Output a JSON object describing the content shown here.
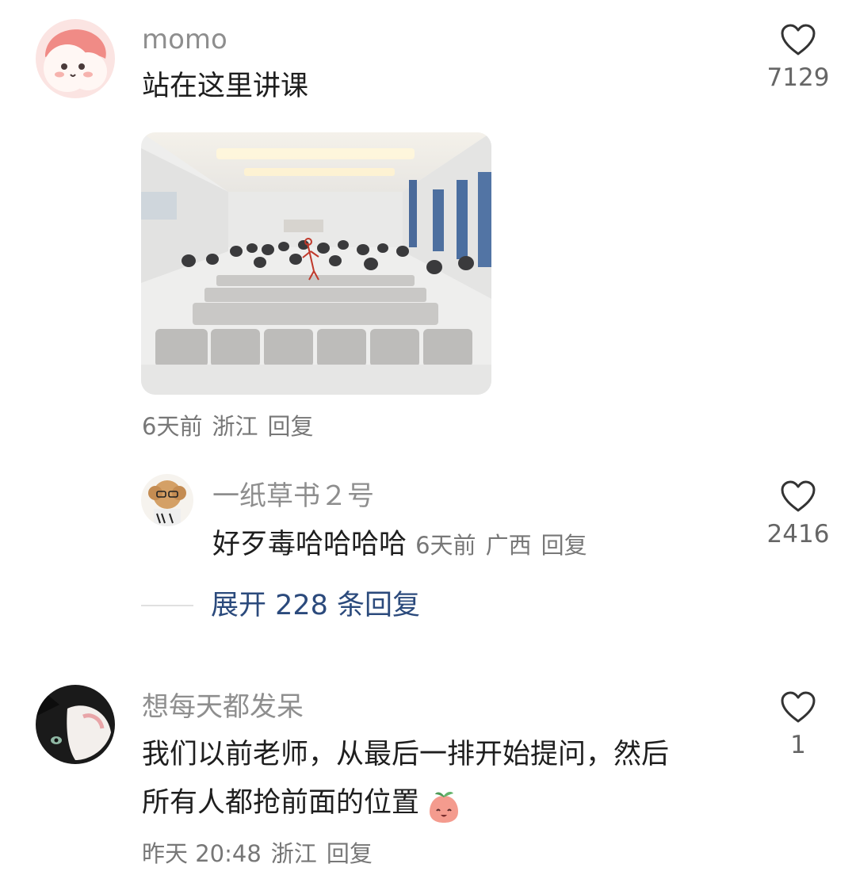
{
  "comments": [
    {
      "user": "momo",
      "text": "站在这里讲课",
      "likes": "7129",
      "time": "6天前",
      "location": "浙江",
      "reply_label": "回复",
      "image_icon": "classroom-photo"
    },
    {
      "user": "想每天都发呆",
      "text_line1": "我们以前老师，从最后一排开始提问，然后",
      "text_line2": "所有人都抢前面的位置",
      "emoji": "smiling-peach-emoji",
      "likes": "1",
      "time": "昨天 20:48",
      "location": "浙江",
      "reply_label": "回复"
    }
  ],
  "replies": [
    {
      "user": "一纸草书２号",
      "text": "好歹毒哈哈哈哈",
      "time": "6天前",
      "location": "广西",
      "reply_label": "回复",
      "likes": "2416"
    }
  ],
  "expand": {
    "label": "展开 228 条回复"
  },
  "colors": {
    "accent_link": "#2b4a7c",
    "muted": "#8e8e8e"
  },
  "icons": [
    "heart-outline-icon",
    "avatar-cartoon",
    "avatar-dog",
    "avatar-cat"
  ]
}
